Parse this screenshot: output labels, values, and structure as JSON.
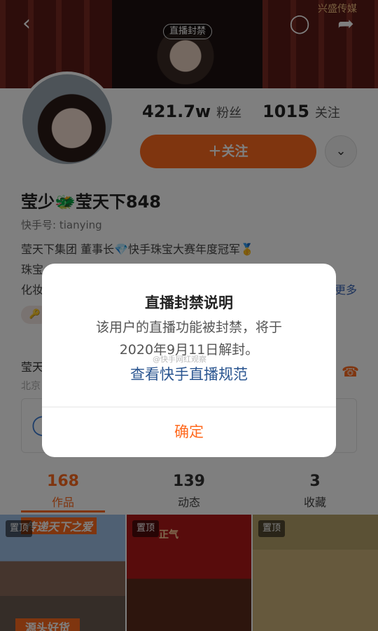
{
  "header": {
    "back_icon": "‹",
    "live_badge": "直播封禁",
    "comment_icon": "◯",
    "share_icon": "➦",
    "top_watermark": "兴盛传媒"
  },
  "profile": {
    "fans_count": "421.7w",
    "fans_label": "粉丝",
    "following_count": "1015",
    "following_label": "关注",
    "follow_button": "＋关注",
    "more_icon": "⌄",
    "nickname": "莹少🐲莹天下848",
    "user_id": "快手号: tianying",
    "bio_line1": "莹天下集团 董事长💎快手珠宝大赛年度冠军🥇",
    "bio_line2": "珠宝",
    "bio_line3": "化妆",
    "more_link": "更多",
    "tag_icon": "🔑",
    "shop_name": "莹天",
    "shop_location": "北京",
    "phone_icon": "☎",
    "chat_icon": "◯"
  },
  "tabs": [
    {
      "count": "168",
      "label": "作品",
      "active": true
    },
    {
      "count": "139",
      "label": "动态",
      "active": false
    },
    {
      "count": "3",
      "label": "收藏",
      "active": false
    }
  ],
  "grid": [
    {
      "pin": "置顶",
      "caption_top": "传递天下之爱",
      "caption_bottom": "源头好货"
    },
    {
      "pin": "置顶",
      "caption_top": "正气"
    },
    {
      "pin": "置顶"
    }
  ],
  "dialog": {
    "title": "直播封禁说明",
    "body_line1": "该用户的直播功能被封禁，将于",
    "body_line2": "2020年9月11日解封。",
    "link": "查看快手直播规范",
    "confirm": "确定",
    "watermark": "@快手网红观察"
  },
  "colors": {
    "accent": "#ff6a1f",
    "link": "#2a5590"
  }
}
